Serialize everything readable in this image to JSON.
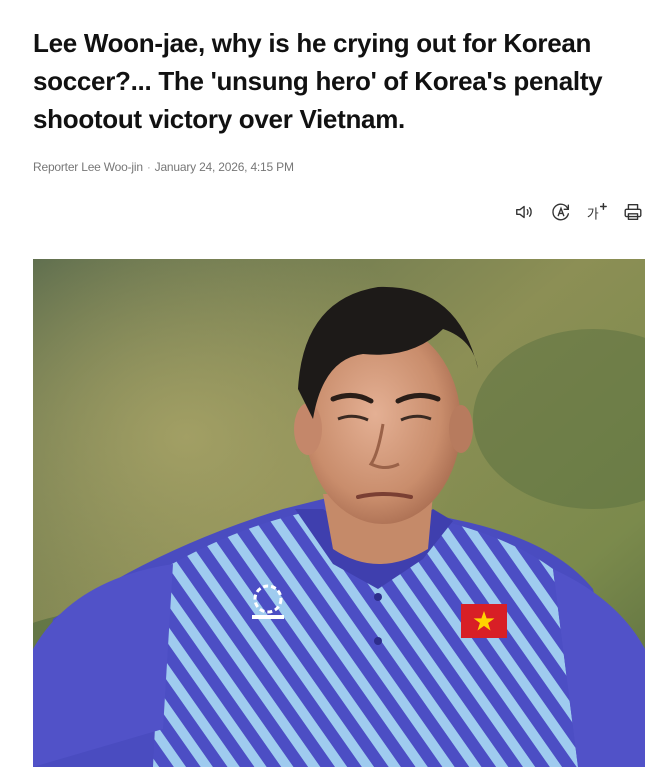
{
  "article": {
    "headline": "Lee Woon-jae, why is he crying out for Korean soccer?... The 'unsung hero' of Korea's penalty shootout victory over Vietnam.",
    "reporter": "Reporter Lee Woo-jin",
    "separator": "·",
    "date": "January 24, 2026, 4:15 PM"
  },
  "toolbar": {
    "icons": [
      "speaker-icon",
      "auto-translate-icon",
      "font-size-icon",
      "print-icon"
    ],
    "font_size_glyph": "가"
  },
  "photo": {
    "description_icon": "news-photo",
    "colors": {
      "background_green": "#6d7b52",
      "shirt_blue": "#4f4fc4",
      "stripe_light": "#9ec9ee",
      "flag_red": "#d81f26",
      "flag_star": "#ffd400"
    }
  }
}
